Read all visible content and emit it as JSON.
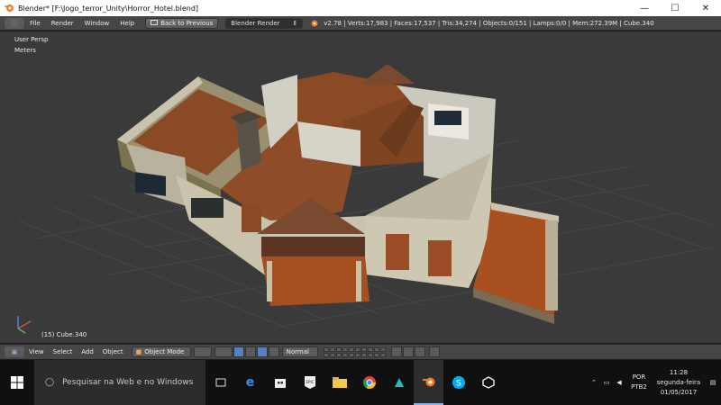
{
  "window": {
    "title": "Blender* [F:\\Jogo_terror_Unity\\Horror_Hotel.blend]",
    "minimize_label": "—",
    "maximize_label": "☐",
    "close_label": "✕"
  },
  "info_header": {
    "menus": [
      "File",
      "Render",
      "Window",
      "Help"
    ],
    "back_button": "Back to Previous",
    "render_engine": "Blender Render",
    "stats": "v2.78 | Verts:17,983 | Faces:17,537 | Tris:34,274 | Objects:0/151 | Lamps:0/0 | Mem:272.39M | Cube.340"
  },
  "viewport": {
    "view_name": "User Persp",
    "units": "Meters",
    "object_info": "(15) Cube.340"
  },
  "view3d_header": {
    "menus": [
      "View",
      "Select",
      "Add",
      "Object"
    ],
    "mode": "Object Mode",
    "orientation": "Normal"
  },
  "taskbar": {
    "search_placeholder": "Pesquisar na Web e no Windows",
    "language": "POR",
    "layout": "PTB2",
    "time": "11:28",
    "day": "segunda-feira",
    "date": "01/05/2017",
    "icons": [
      "task-view-icon",
      "edge-icon",
      "store-icon",
      "epic-games-icon",
      "file-explorer-icon",
      "chrome-icon",
      "app-icon",
      "blender-icon",
      "skype-icon",
      "unity-icon"
    ]
  },
  "colors": {
    "viewport_bg": "#3a3a3a",
    "header_bg": "#464646",
    "taskbar_bg": "#101010",
    "accent_blue": "#5680c2"
  }
}
